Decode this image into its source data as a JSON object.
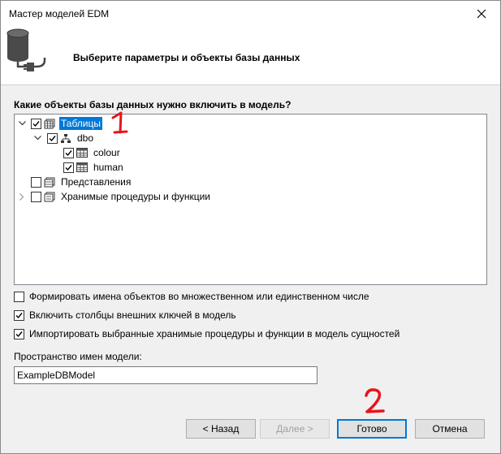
{
  "window": {
    "title": "Мастер моделей EDM"
  },
  "header": {
    "text": "Выберите параметры и объекты базы данных"
  },
  "section_label": "Какие объекты базы данных нужно включить в модель?",
  "tree": {
    "tables": {
      "label": "Таблицы",
      "checked": true,
      "expanded": true,
      "selected": true
    },
    "dbo": {
      "label": "dbo",
      "checked": true,
      "expanded": true
    },
    "colour": {
      "label": "colour",
      "checked": true
    },
    "human": {
      "label": "human",
      "checked": true
    },
    "views": {
      "label": "Представления",
      "checked": false
    },
    "procs": {
      "label": "Хранимые процедуры и функции",
      "checked": false,
      "expanded": false
    }
  },
  "options": {
    "pluralize": {
      "label": "Формировать имена объектов во множественном или единственном числе",
      "checked": false
    },
    "foreign_keys": {
      "label": "Включить столбцы внешних ключей в модель",
      "checked": true
    },
    "import_procs": {
      "label": "Импортировать выбранные хранимые процедуры и функции в модель сущностей",
      "checked": true
    }
  },
  "namespace": {
    "label": "Пространство имен модели:",
    "value": "ExampleDBModel"
  },
  "buttons": {
    "back": "< Назад",
    "next": "Далее >",
    "finish": "Готово",
    "cancel": "Отмена"
  },
  "annotations": {
    "first": "1",
    "second": "2",
    "color": "#e8141c"
  },
  "colors": {
    "selection": "#0078d7",
    "check": "#000000"
  }
}
